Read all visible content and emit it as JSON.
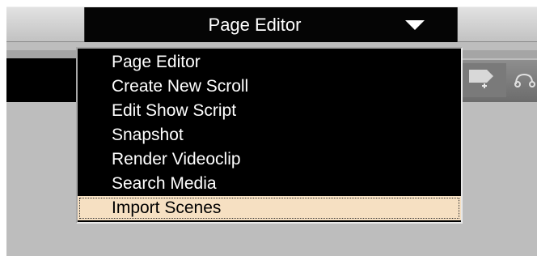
{
  "combo": {
    "selected_label": "Page Editor"
  },
  "menu": {
    "items": [
      {
        "label": "Page Editor"
      },
      {
        "label": "Create New Scroll"
      },
      {
        "label": "Edit Show Script"
      },
      {
        "label": "Snapshot"
      },
      {
        "label": "Render Videoclip"
      },
      {
        "label": "Search Media"
      },
      {
        "label": "Import Scenes"
      }
    ],
    "highlighted_item": "Import Scenes"
  },
  "colors": {
    "menu_background": "#000000",
    "highlight_background": "#f6e0c2",
    "topbar": "#d0d0d0",
    "workspace": "#bdbdbd"
  },
  "icons": [
    "chevron-down-icon",
    "insert-clip-icon",
    "link-node-icon"
  ]
}
